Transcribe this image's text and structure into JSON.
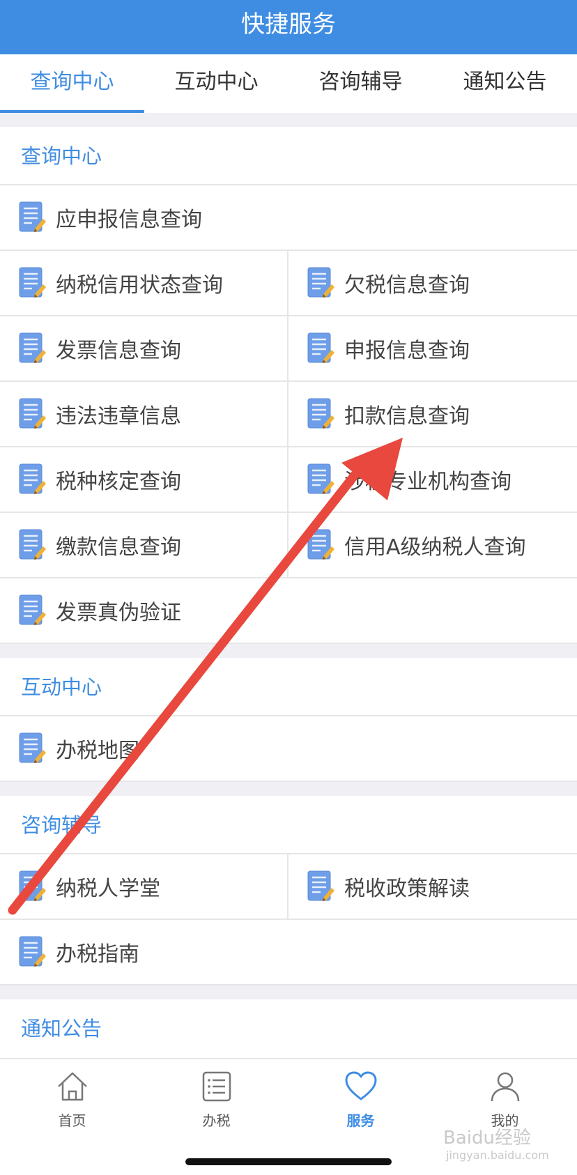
{
  "header": {
    "title": "快捷服务"
  },
  "tabs": [
    {
      "label": "查询中心",
      "active": true
    },
    {
      "label": "互动中心",
      "active": false
    },
    {
      "label": "咨询辅导",
      "active": false
    },
    {
      "label": "通知公告",
      "active": false
    }
  ],
  "sections": {
    "query": {
      "title": "查询中心",
      "items": [
        "应申报信息查询",
        "纳税信用状态查询",
        "欠税信息查询",
        "发票信息查询",
        "申报信息查询",
        "违法违章信息",
        "扣款信息查询",
        "税种核定查询",
        "涉税专业机构查询",
        "缴款信息查询",
        "信用A级纳税人查询",
        "发票真伪验证"
      ]
    },
    "interact": {
      "title": "互动中心",
      "items": [
        "办税地图"
      ]
    },
    "consult": {
      "title": "咨询辅导",
      "items": [
        "纳税人学堂",
        "税收政策解读",
        "办税指南"
      ]
    },
    "notice": {
      "title": "通知公告"
    }
  },
  "bottom_nav": [
    {
      "label": "首页",
      "icon": "home-icon",
      "active": false
    },
    {
      "label": "办税",
      "icon": "list-icon",
      "active": false
    },
    {
      "label": "服务",
      "icon": "heart-icon",
      "active": true
    },
    {
      "label": "我的",
      "icon": "user-icon",
      "active": false
    }
  ],
  "watermark": {
    "text": "Baidu经验",
    "sub": "jingyan.baidu.com"
  },
  "colors": {
    "accent": "#3f8de2",
    "arrow": "#e8483d",
    "background": "#efeff4"
  },
  "icons": {
    "item_icon": "document-edit-icon"
  }
}
